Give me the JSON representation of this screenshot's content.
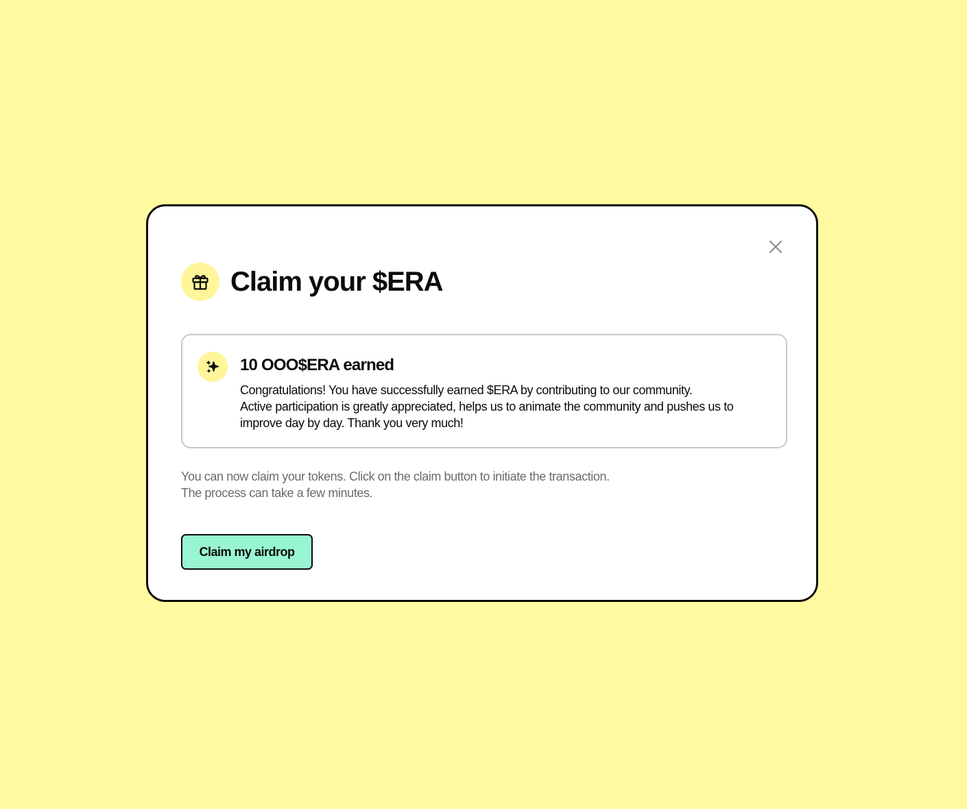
{
  "modal": {
    "title": "Claim your $ERA",
    "header_icon": "gift-icon",
    "close_icon": "close-icon",
    "reward": {
      "icon": "sparkle-icon",
      "amount_text": "10 OOO$ERA earned",
      "message_line1": "Congratulations! You have successfully earned $ERA by contributing to our community.",
      "message_line2": "Active participation is greatly appreciated, helps us to animate the community and pushes us to improve day by day. Thank you very much!"
    },
    "info_line1": "You can now claim your tokens. Click on the claim button to initiate the transaction.",
    "info_line2": "The process can take a few minutes.",
    "claim_button_label": "Claim my airdrop"
  },
  "colors": {
    "page_background": "#FFFAA0",
    "icon_badge": "#FFF59A",
    "claim_button": "#98F5D2",
    "border": "#0b0b0b",
    "muted_text": "#6b6b6b"
  }
}
